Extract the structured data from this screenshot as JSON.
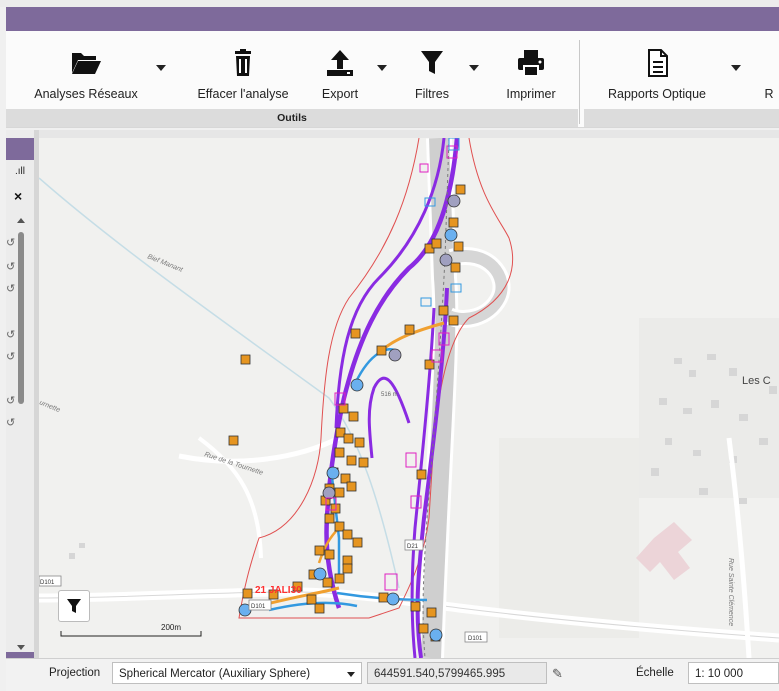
{
  "ribbon": {
    "buttons": [
      {
        "label": "Analyses Réseaux",
        "icon": "folder-open-icon"
      },
      {
        "label": "Effacer l'analyse",
        "icon": "trash-icon"
      },
      {
        "label": "Export",
        "icon": "upload-icon"
      },
      {
        "label": "Filtres",
        "icon": "filter-icon"
      },
      {
        "label": "Imprimer",
        "icon": "printer-icon"
      },
      {
        "label": "Rapports Optique",
        "icon": "report-icon"
      },
      {
        "label": "R",
        "icon": ""
      }
    ],
    "group_label": "Outils"
  },
  "left_panel": {
    "signal": ".ıll",
    "close": "×"
  },
  "map": {
    "labels": {
      "bief_manant": "Bief Manant",
      "rue_tournette": "Rue de la Tournette",
      "tournette": "urnette",
      "les": "Les C",
      "rue_sainte": "Rue Sainte Clémence",
      "elevation": "516 m",
      "d101_left": "D101",
      "d101_bottom": "D101",
      "d101_mid": "D101",
      "d21": "D21",
      "cable_label": "21 JALI30"
    },
    "scale_bar": "200m",
    "colors": {
      "purple_cable": "#8a2be2",
      "orange_cable": "#f0a030",
      "blue_cable": "#3399e0",
      "boundary": "#e05050",
      "magenta": "#e020c0",
      "node_orange": "#e69520",
      "node_blue": "#6ab0ef"
    }
  },
  "statusbar": {
    "projection_label": "Projection",
    "projection_value": "Spherical Mercator (Auxiliary Sphere)",
    "coordinates": "644591.540,5799465.995",
    "scale_label": "Échelle",
    "scale_value": "1: 10 000"
  }
}
